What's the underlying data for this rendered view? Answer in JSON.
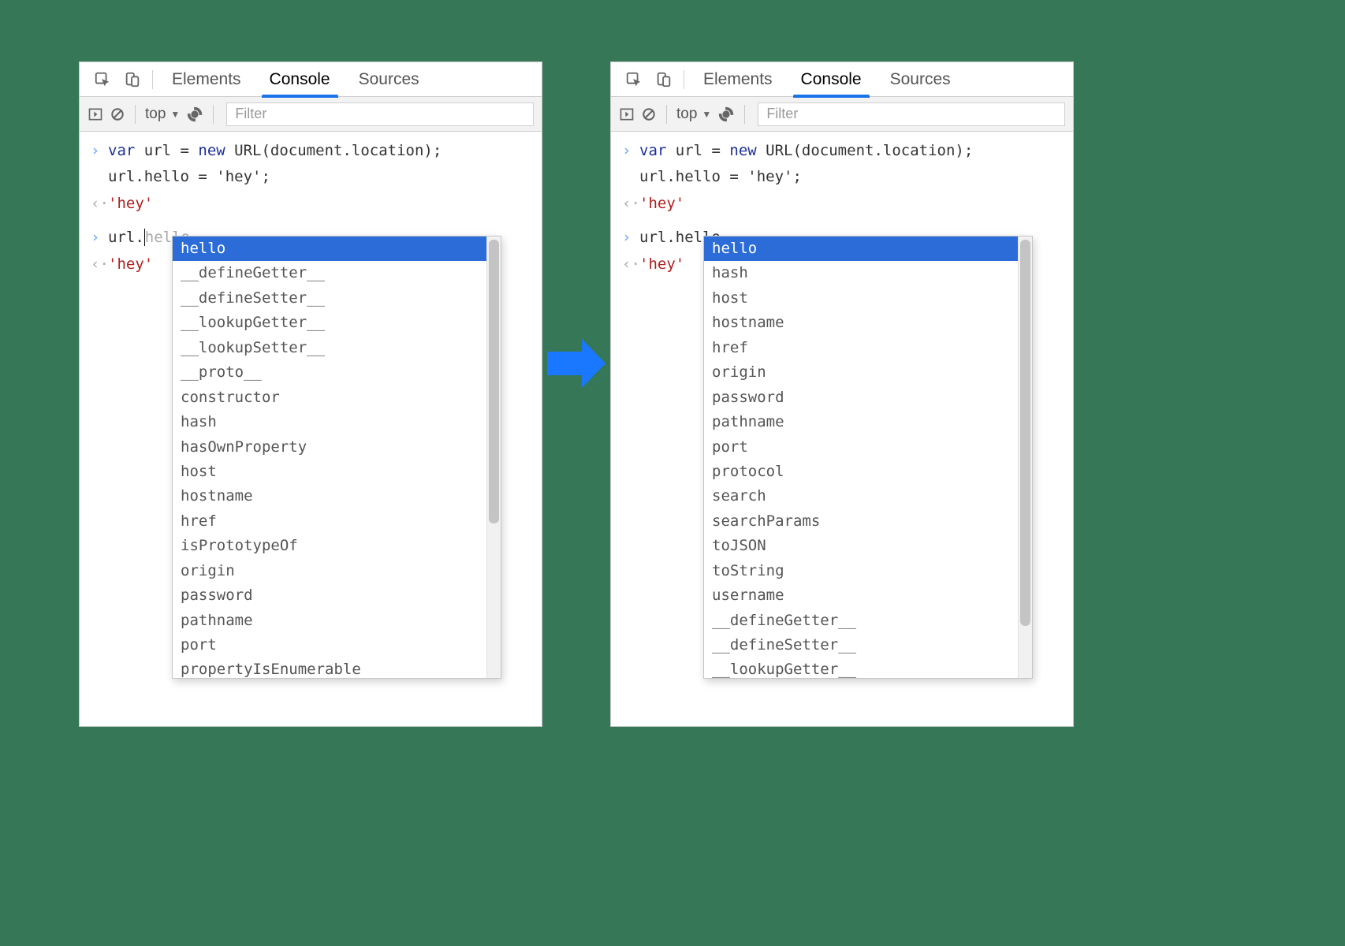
{
  "tabs": {
    "elements": "Elements",
    "console": "Console",
    "sources": "Sources"
  },
  "toolbar": {
    "context": "top",
    "filter_placeholder": "Filter"
  },
  "code": {
    "line1_pre": "var",
    "line1_mid": " url = ",
    "line1_new": "new",
    "line1_rest": " URL(document.location);",
    "line2": "url.hello = 'hey';",
    "result": "'hey'",
    "prompt_left": "url.",
    "prompt_ghost_left": "hello",
    "prompt_right": "url.hello",
    "result2": "'hey'"
  },
  "ac_left": [
    "hello",
    "__defineGetter__",
    "__defineSetter__",
    "__lookupGetter__",
    "__lookupSetter__",
    "__proto__",
    "constructor",
    "hash",
    "hasOwnProperty",
    "host",
    "hostname",
    "href",
    "isPrototypeOf",
    "origin",
    "password",
    "pathname",
    "port",
    "propertyIsEnumerable"
  ],
  "ac_right": [
    "hello",
    "hash",
    "host",
    "hostname",
    "href",
    "origin",
    "password",
    "pathname",
    "port",
    "protocol",
    "search",
    "searchParams",
    "toJSON",
    "toString",
    "username",
    "__defineGetter__",
    "__defineSetter__",
    "__lookupGetter__"
  ]
}
